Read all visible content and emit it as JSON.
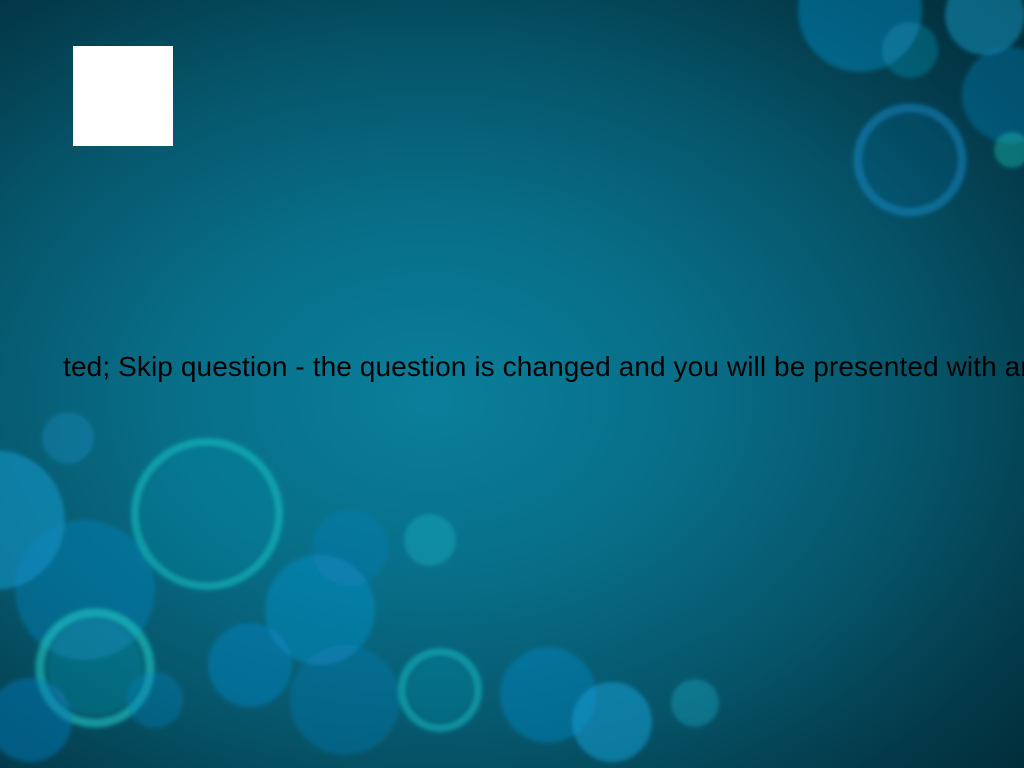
{
  "colors": {
    "background_center": "#0a7f9b",
    "background_edge": "#012530",
    "bubble_blue": "#0a8fc8",
    "bubble_teal": "#17c6c6",
    "text": "#000000",
    "logo_placeholder": "#ffffff"
  },
  "logo": {
    "icon": "blank-logo-placeholder"
  },
  "ticker": {
    "text": "ted; Skip question - the question is changed and you will be presented with an"
  }
}
